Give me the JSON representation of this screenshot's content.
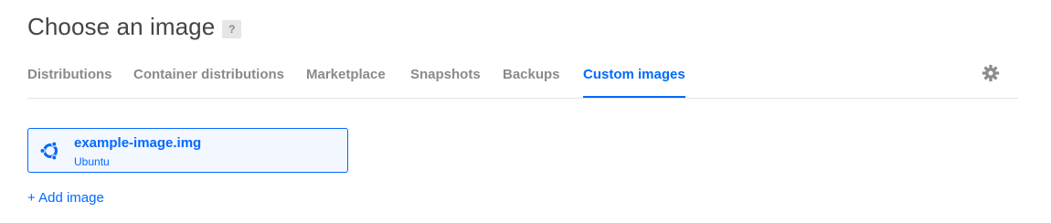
{
  "header": {
    "title": "Choose an image",
    "help_badge": "?"
  },
  "tabs": [
    {
      "label": "Distributions",
      "active": false
    },
    {
      "label": "Container distributions",
      "active": false
    },
    {
      "label": "Marketplace",
      "active": false
    },
    {
      "label": "Snapshots",
      "active": false
    },
    {
      "label": "Backups",
      "active": false
    },
    {
      "label": "Custom images",
      "active": true
    }
  ],
  "settings": {
    "icon": "gear-icon"
  },
  "images": [
    {
      "name": "example-image.img",
      "os": "Ubuntu",
      "icon": "ubuntu-icon",
      "selected": true
    }
  ],
  "add_image_label": "+ Add image",
  "colors": {
    "accent": "#0069ff",
    "tab_inactive": "#8a8a8a",
    "card_background": "#f3f7ff",
    "divider": "#e3e3e3"
  }
}
